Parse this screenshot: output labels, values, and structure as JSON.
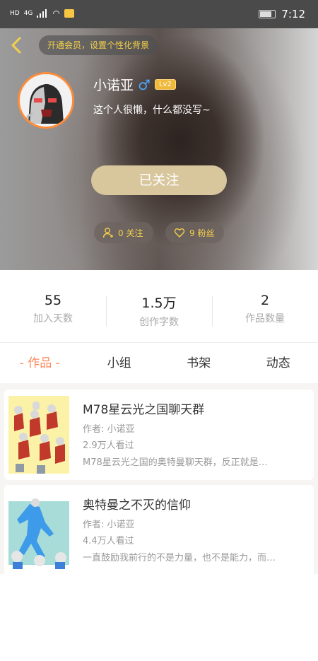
{
  "status_bar": {
    "network": "HD",
    "signal_type": "4G",
    "time": "7:12"
  },
  "header": {
    "vip_text": "开通会员，设置个性化背景",
    "user_name": "小诺亚",
    "gender_symbol": "♂",
    "level": "Lv2",
    "signature": "这个人很懒，什么都没写~",
    "follow_button": "已关注",
    "following_count": "0 关注",
    "fans_count": "9 粉丝"
  },
  "stats": [
    {
      "value": "55",
      "label": "加入天数"
    },
    {
      "value": "1.5万",
      "label": "创作字数"
    },
    {
      "value": "2",
      "label": "作品数量"
    }
  ],
  "tabs": [
    {
      "label": "- 作品 -",
      "active": true
    },
    {
      "label": "小组",
      "active": false
    },
    {
      "label": "书架",
      "active": false
    },
    {
      "label": "动态",
      "active": false
    }
  ],
  "works": [
    {
      "title": "M78星云光之国聊天群",
      "author": "作者: 小诺亚",
      "views": "2.9万人看过",
      "description": "M78星云光之国的奥特曼聊天群，反正就是…"
    },
    {
      "title": "奥特曼之不灭的信仰",
      "author": "作者: 小诺亚",
      "views": "4.4万人看过",
      "description": "一直鼓励我前行的不是力量，也不是能力，而…"
    }
  ],
  "colors": {
    "accent": "#ff8a5b",
    "gold": "#f4d04a",
    "follow_button": "#d8c79d",
    "avatar_border": "#ff8c3a"
  }
}
